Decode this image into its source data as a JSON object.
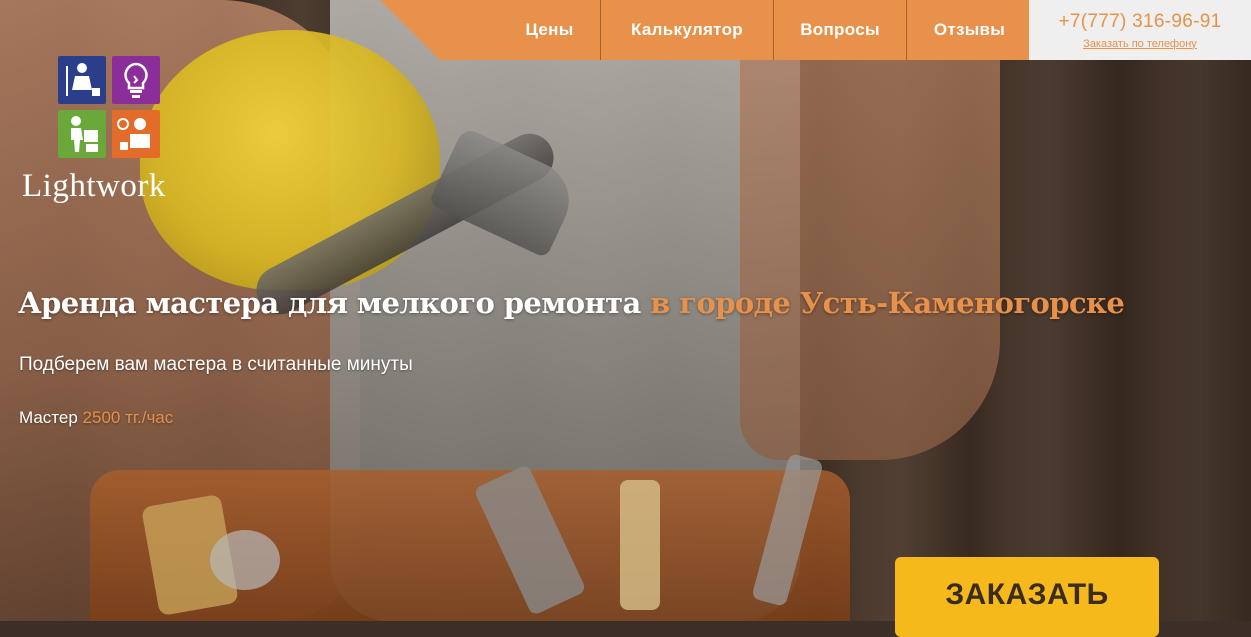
{
  "nav": {
    "items": [
      {
        "label": "Цены"
      },
      {
        "label": "Калькулятор"
      },
      {
        "label": "Вопросы"
      },
      {
        "label": "Отзывы"
      }
    ]
  },
  "contact": {
    "phone": "+7(777) 316-96-91",
    "callback_link": "Заказать по телефону"
  },
  "logo": {
    "text": "Lightwork"
  },
  "hero": {
    "headline_main": "Аренда мастера для мелкого ремонта",
    "headline_accent": "в городе Усть-Каменогорске",
    "subtitle": "Подберем вам мастера в считанные минуты",
    "price_label": "Мастер",
    "price_value": "2500 тг./час",
    "cta_label": "ЗАКАЗАТЬ"
  },
  "colors": {
    "accent_orange": "#e8914a",
    "cta_yellow": "#f6b91c",
    "tile_blue": "#2a3e8c",
    "tile_purple": "#8c2e9a",
    "tile_green": "#6aa83a",
    "tile_orange": "#e36c2a"
  }
}
